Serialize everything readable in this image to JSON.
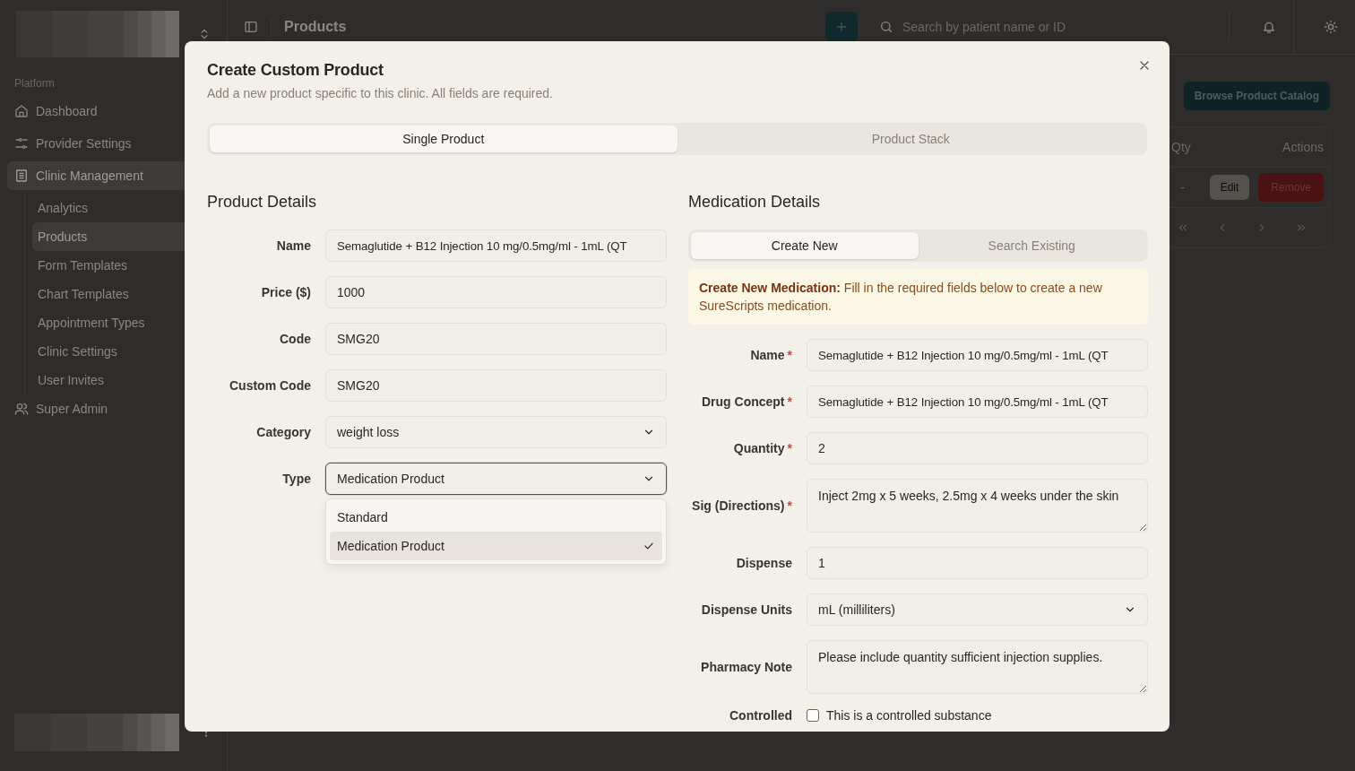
{
  "sidebar": {
    "section": "Platform",
    "items": [
      {
        "label": "Dashboard",
        "selected": false
      },
      {
        "label": "Provider Settings",
        "selected": false
      },
      {
        "label": "Clinic Management",
        "selected": true,
        "children": [
          {
            "label": "Analytics",
            "selected": false
          },
          {
            "label": "Products",
            "selected": true
          },
          {
            "label": "Form Templates",
            "selected": false
          },
          {
            "label": "Chart Templates",
            "selected": false
          },
          {
            "label": "Appointment Types",
            "selected": false
          },
          {
            "label": "Clinic Settings",
            "selected": false
          },
          {
            "label": "User Invites",
            "selected": false
          }
        ]
      },
      {
        "label": "Super Admin",
        "selected": false
      }
    ]
  },
  "topbar": {
    "title": "Products",
    "search": {
      "placeholder": "Search by patient name or ID"
    }
  },
  "page": {
    "catalog_button": "Browse Product Catalog",
    "table": {
      "columns": [
        "Qty",
        "Actions"
      ],
      "rows": [
        {
          "qty": "-",
          "actions": [
            "Edit",
            "Remove"
          ]
        }
      ]
    }
  },
  "dialog": {
    "title": "Create Custom Product",
    "description": "Add a new product specific to this clinic. All fields are required.",
    "tabs": [
      {
        "label": "Single Product",
        "selected": true
      },
      {
        "label": "Product Stack",
        "selected": false
      }
    ],
    "product_details": {
      "heading": "Product Details",
      "fields": [
        {
          "label": "Name",
          "kind": "input",
          "value": "Semaglutide + B12 Injection 10 mg/0.5mg/ml - 1mL (QT"
        },
        {
          "label": "Price ($)",
          "kind": "input",
          "value": "1000"
        },
        {
          "label": "Code",
          "kind": "input",
          "value": "SMG20"
        },
        {
          "label": "Custom Code",
          "kind": "input",
          "value": "SMG20"
        },
        {
          "label": "Category",
          "kind": "select",
          "value": "weight loss",
          "focused": false
        },
        {
          "label": "Type",
          "kind": "select",
          "value": "Medication Product",
          "focused": true
        }
      ],
      "dropdown": {
        "options": [
          {
            "label": "Standard",
            "selected": false
          },
          {
            "label": "Medication Product",
            "selected": true
          }
        ]
      }
    },
    "medication": {
      "heading": "Medication Details",
      "tabs": [
        {
          "label": "Create New",
          "selected": true
        },
        {
          "label": "Search Existing",
          "selected": false
        }
      ],
      "notice": "**Create New Medication:** Fill in the required fields below to create a new SureScripts medication.",
      "fields": [
        {
          "label": "Name",
          "required_mark": "*",
          "kind": "input",
          "value": "Semaglutide + B12 Injection 10 mg/0.5mg/ml - 1mL (QT"
        },
        {
          "label": "Drug Concept",
          "required_mark": "*",
          "kind": "input",
          "value": "Semaglutide + B12 Injection 10 mg/0.5mg/ml - 1mL (QT"
        },
        {
          "label": "Quantity",
          "required_mark": "*",
          "kind": "input",
          "value": "2"
        },
        {
          "label": "Sig (Directions)",
          "required_mark": "*",
          "kind": "textarea",
          "value": "Inject 2mg x 5 weeks, 2.5mg x 4 weeks under the skin"
        },
        {
          "label": "Dispense",
          "kind": "input",
          "value": "1"
        },
        {
          "label": "Dispense Units",
          "kind": "select",
          "value": "mL (milliliters)"
        },
        {
          "label": "Pharmacy Note",
          "kind": "textarea",
          "value": "Please include quantity sufficient injection supplies."
        },
        {
          "label": "Controlled",
          "kind": "checkbox",
          "checked": false,
          "text": "This is a controlled substance"
        }
      ]
    }
  }
}
